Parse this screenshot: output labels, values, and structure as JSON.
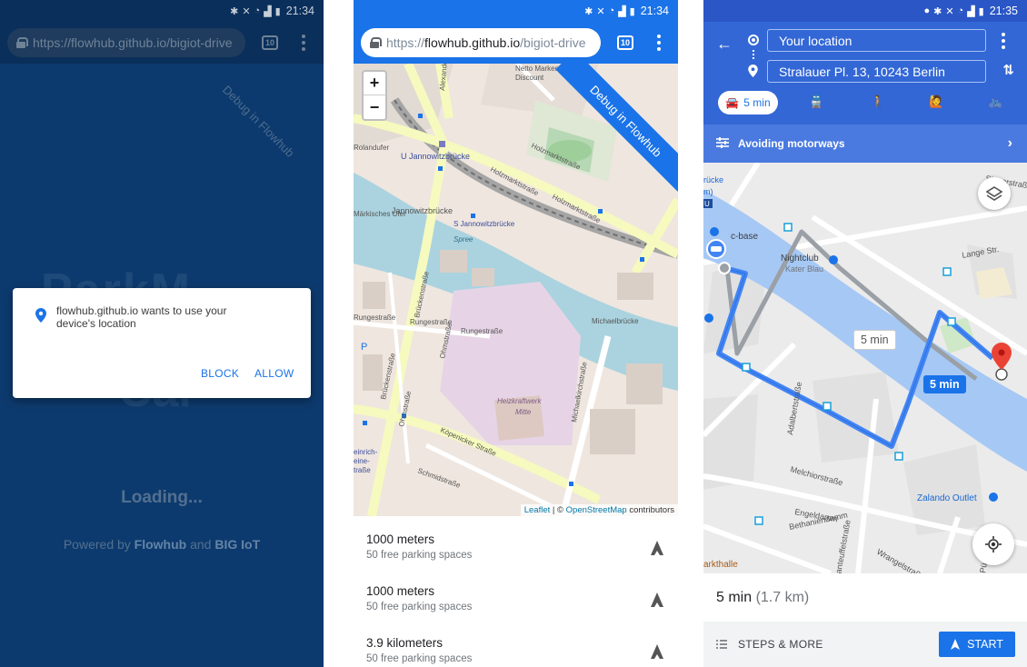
{
  "status": {
    "time_1": "21:34",
    "time_2": "21:34",
    "time_3": "21:35"
  },
  "browser": {
    "url_scheme": "https://",
    "url_host": "flowhub.github.io",
    "url_path": "/bigiot-drive",
    "tab_count": "10"
  },
  "screen1": {
    "ribbon": "Debug in Flowhub",
    "permission": {
      "message": "flowhub.github.io wants to use your device's location",
      "block_label": "BLOCK",
      "allow_label": "ALLOW"
    },
    "loading": "Loading...",
    "powered_prefix": "Powered by",
    "powered_a": "Flowhub",
    "powered_and": "and",
    "powered_b": "BIG IoT"
  },
  "screen2": {
    "ribbon": "Debug in Flowhub",
    "zoom_in": "+",
    "zoom_out": "−",
    "attribution": {
      "leaflet": "Leaflet",
      "sep": " | © ",
      "osm": "OpenStreetMap",
      "suffix": " contributors"
    },
    "map_labels": [
      "Netto Marken-Discount",
      "U Jannowitzbrücke",
      "Holzmarktstraße",
      "Jannowitzbrücke",
      "S Jannowitzbrücke",
      "Spree",
      "Märkisches Ufer",
      "Rolandufer",
      "Brückenstraße",
      "Rungestraße",
      "Michaelbrücke",
      "Heizkraftwerk Mitte",
      "Ohmstraße",
      "Michaelkirchstraße",
      "Köpenicker Straße",
      "Heinrich-Heine-Straße",
      "Schmidstraße",
      "Alexanderstraße",
      "P"
    ],
    "results": [
      {
        "distance": "1000 meters",
        "spaces": "50 free parking spaces"
      },
      {
        "distance": "1000 meters",
        "spaces": "50 free parking spaces"
      },
      {
        "distance": "3.9 kilometers",
        "spaces": "50 free parking spaces"
      }
    ]
  },
  "screen3": {
    "from": "Your location",
    "to": "Stralauer Pl. 13, 10243 Berlin",
    "mode_drive": "5 min",
    "avoid": "Avoiding motorways",
    "alt_time": "5 min",
    "main_time": "5 min",
    "map_labels": [
      "Singerstraße",
      "c-base",
      "Nightclub",
      "Kater Blau",
      "Lange Str.",
      "Adalbertstraße",
      "Melchiorstraße",
      "Engeldamm",
      "Bethaniendamm",
      "Wrangelstraße",
      "Zalando Outlet",
      "Markthalle",
      "Pücklerstraße",
      "brücke",
      "m)",
      "U"
    ],
    "duration": "5 min",
    "distance": "(1.7 km)",
    "steps": "STEPS & MORE",
    "start": "START"
  },
  "colors": {
    "flowhub_bg": "#0d3a6e",
    "chrome_blue": "#1a73e8",
    "maps_header": "#3367d6",
    "route_blue": "#4285f4",
    "destination_red": "#ea4335"
  }
}
